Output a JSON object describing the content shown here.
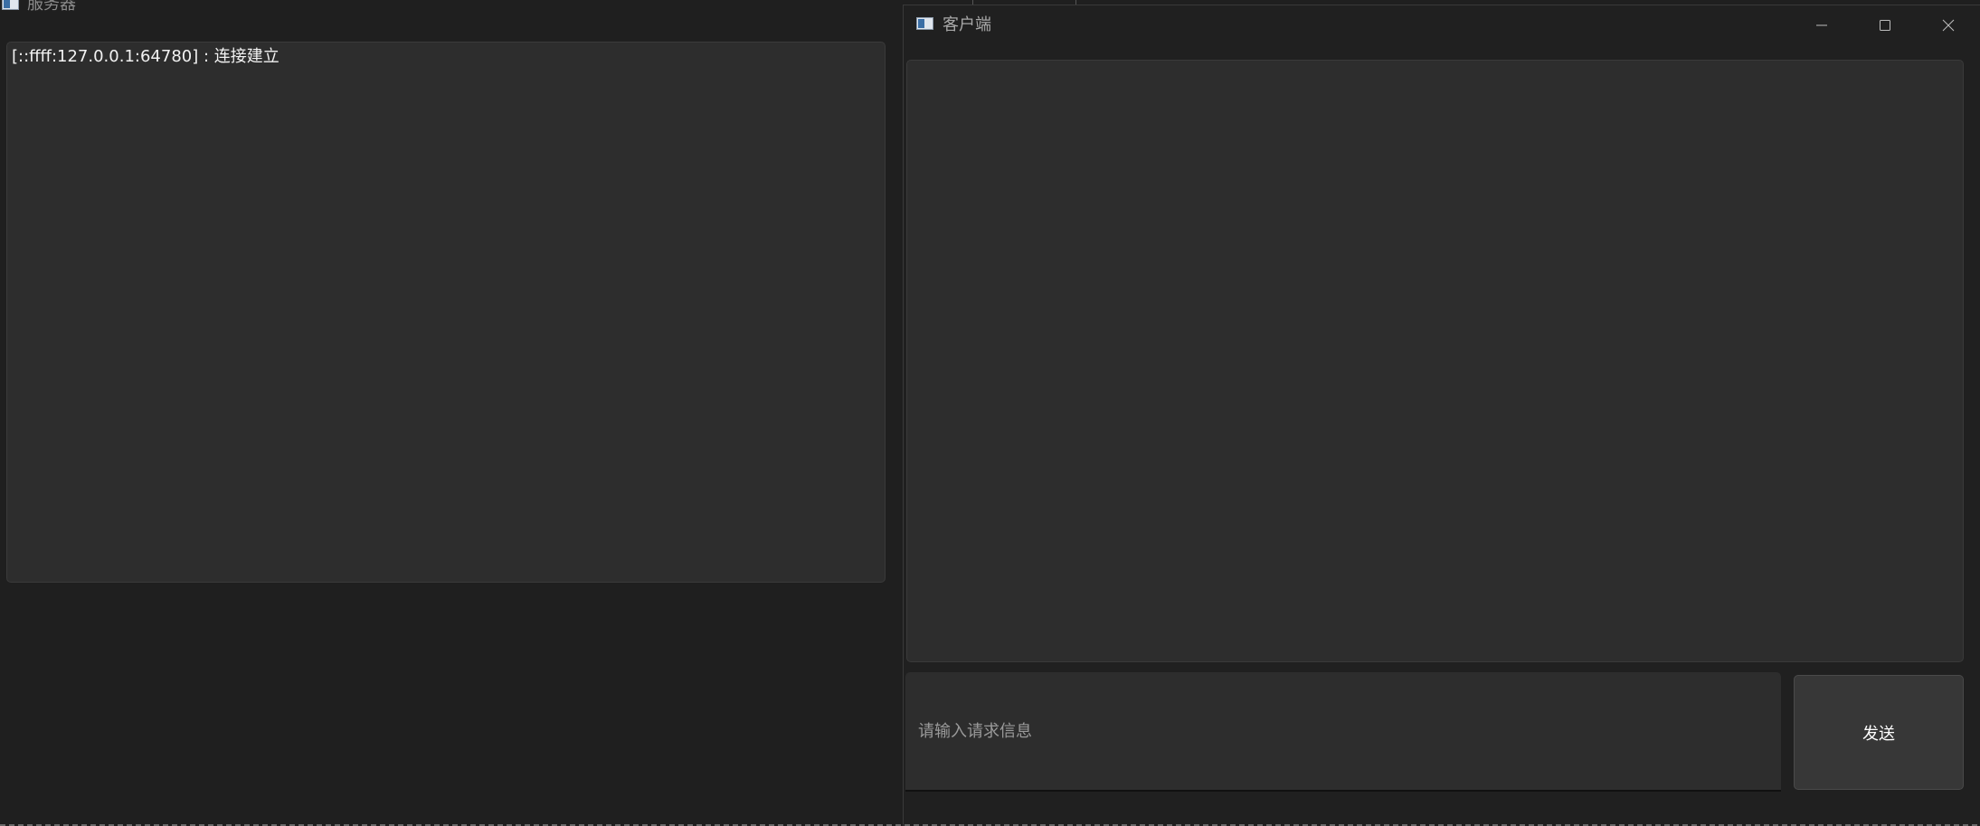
{
  "server_window": {
    "title": "服务器",
    "icon": "app-window-icon",
    "log_lines": [
      "[::ffff:127.0.0.1:64780] : 连接建立"
    ]
  },
  "client_window": {
    "title": "客户端",
    "icon": "app-window-icon",
    "controls": {
      "minimize": "minimize-icon",
      "maximize": "maximize-icon",
      "close": "close-icon"
    },
    "messages": [],
    "input": {
      "value": "",
      "placeholder": "请输入请求信息"
    },
    "send_label": "发送"
  },
  "colors": {
    "background": "#1f1f1f",
    "panel": "#2d2d2d",
    "button": "#373737",
    "text": "#f2f2f2",
    "placeholder": "#9a9a9a"
  }
}
